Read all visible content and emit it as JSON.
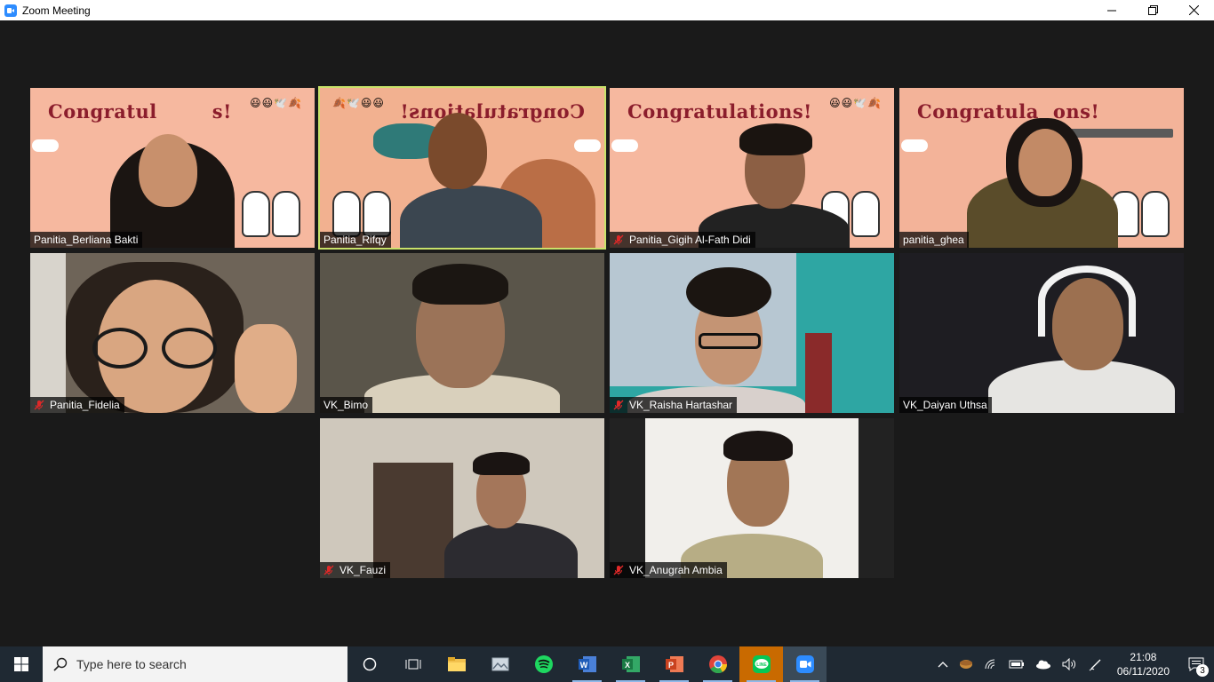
{
  "window": {
    "title": "Zoom Meeting"
  },
  "banner": {
    "text": "Congratulations!",
    "text_partial_1": "Congratul",
    "text_partial_1b": "s!",
    "text_partial_4": "Congratula",
    "text_partial_4b": "ons!"
  },
  "participants": [
    {
      "name": "Panitia_Berliana Bakti",
      "muted": false
    },
    {
      "name": "Panitia_Rifqy",
      "muted": false,
      "active_speaker": true
    },
    {
      "name": "Panitia_Gigih Al-Fath Didi",
      "muted": true
    },
    {
      "name": "panitia_ghea",
      "muted": false
    },
    {
      "name": "Panitia_Fidelia",
      "muted": true
    },
    {
      "name": "VK_Bimo",
      "muted": false
    },
    {
      "name": "VK_Raisha Hartashar",
      "muted": true
    },
    {
      "name": "VK_Daiyan Uthsa",
      "muted": false
    },
    {
      "name": "VK_Fauzi",
      "muted": true
    },
    {
      "name": "VK_Anugrah Ambia",
      "muted": true
    }
  ],
  "taskbar": {
    "search_placeholder": "Type here to search",
    "apps": [
      "cortana-icon",
      "task-view-icon",
      "file-explorer-icon",
      "photos-icon",
      "spotify-icon",
      "word-icon",
      "excel-icon",
      "powerpoint-icon",
      "chrome-icon",
      "line-icon",
      "zoom-icon"
    ],
    "time": "21:08",
    "date": "06/11/2020",
    "notification_count": "3"
  },
  "colors": {
    "banner_bg": "#f6b89f",
    "banner_text": "#8b1d2c",
    "active_outline": "#c9e26a",
    "mute_red": "#e02828",
    "taskbar": "#1f2933"
  }
}
